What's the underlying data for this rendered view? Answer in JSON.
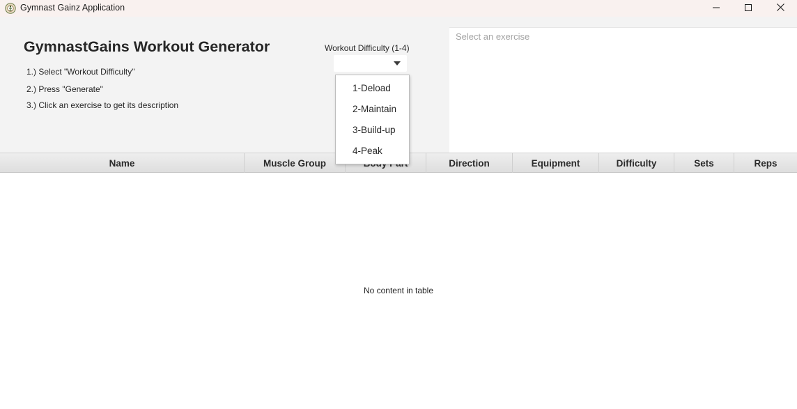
{
  "window": {
    "title": "Gymnast Gainz Application",
    "icon": "gymnast-app-icon",
    "controls": [
      "minimize-icon",
      "maximize-icon",
      "close-icon"
    ]
  },
  "header": {
    "title": "GymnastGains Workout Generator",
    "steps": [
      "1.) Select \"Workout Difficulty\"",
      "2.) Press \"Generate\"",
      "3.) Click an exercise to get its description"
    ]
  },
  "difficulty": {
    "label": "Workout Difficulty (1-4)",
    "selected": "",
    "options": [
      "1-Deload",
      "2-Maintain",
      "3-Build-up",
      "4-Peak"
    ]
  },
  "description": {
    "placeholder": "Select an exercise"
  },
  "table": {
    "columns": [
      "Name",
      "Muscle Group",
      "Body Part",
      "Direction",
      "Equipment",
      "Difficulty",
      "Sets",
      "Reps"
    ],
    "rows": [],
    "empty_message": "No content in table"
  },
  "colors": {
    "titlebar": "#f9f1ef",
    "panel_background": "#f3f3f3",
    "table_header": "#e4e4e4"
  }
}
